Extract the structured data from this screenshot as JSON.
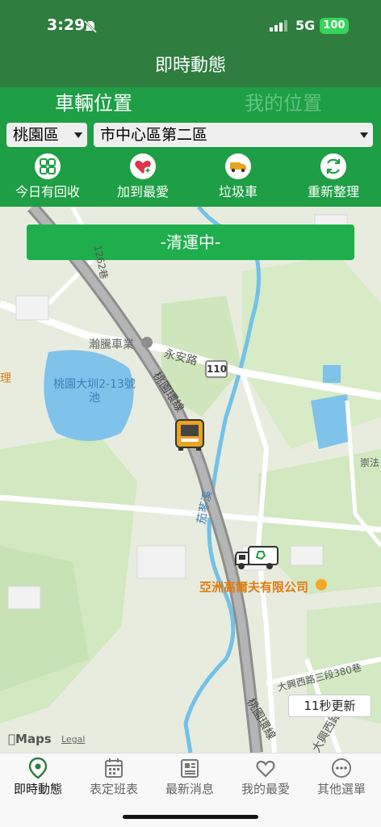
{
  "status_bar": {
    "time": "3:29",
    "network": "5G",
    "battery": "100"
  },
  "header": {
    "title": "即時動態"
  },
  "segments": {
    "vehicle": "車輛位置",
    "mine": "我的位置"
  },
  "filters": {
    "district": "桃園區",
    "route": "市中心區第二區"
  },
  "actions": [
    {
      "label": "今日有回收",
      "icon": "recycle-grid-icon"
    },
    {
      "label": "加到最愛",
      "icon": "heart-add-icon"
    },
    {
      "label": "垃圾車",
      "icon": "truck-icon"
    },
    {
      "label": "重新整理",
      "icon": "refresh-icon"
    }
  ],
  "map": {
    "status_banner": "-清運中-",
    "refresh_timer": "11秒更新",
    "attribution": "Maps",
    "legal": "Legal",
    "labels": {
      "lane_1262": "1262巷",
      "business": "瀚騰車業",
      "road_yongan": "永安路",
      "shield_110": "110",
      "ring_road_1": "桃園環線",
      "ring_road_2": "桃園環線",
      "pond": "桃園大圳2-13號池",
      "creek": "茄苳溪",
      "company": "亞洲高爾夫有限公司",
      "road_daxing": "大興西路三段380巷",
      "road_daxing_2": "大興西路",
      "edge_left": "理",
      "edge_right": "崇法"
    }
  },
  "tabs": [
    {
      "label": "即時動態",
      "icon": "location-pin-icon"
    },
    {
      "label": "表定班表",
      "icon": "calendar-icon"
    },
    {
      "label": "最新消息",
      "icon": "newspaper-icon"
    },
    {
      "label": "我的最愛",
      "icon": "heart-icon"
    },
    {
      "label": "其他選單",
      "icon": "more-icon"
    }
  ],
  "colors": {
    "header": "#2f7d3f",
    "panel": "#1e9e45",
    "banner": "#1fae4c"
  }
}
